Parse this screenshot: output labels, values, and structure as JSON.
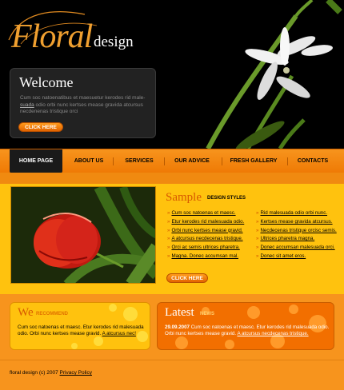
{
  "logo": {
    "floral": "Floral",
    "design": "design"
  },
  "welcome": {
    "title": "Welcome",
    "text_before_link": "Cum soc natoenatibus et maesuetur kerodes rid male-",
    "link": "suada",
    "text_after_link": " odio orbi nunc kertses mease gravida atcursus necdenenas tristique orci",
    "button": "CLICK HERE"
  },
  "nav": [
    "HOME PAGE",
    "ABOUT US",
    "SERVICES",
    "OUR ADVICE",
    "FRESH GALLERY",
    "CONTACTS"
  ],
  "sample": {
    "title": "Sample",
    "subtitle": "DESIGN STYLES",
    "left_items": [
      "Cum soc natoenas et maesc.",
      "Etur kerodes rid malesuada odio.",
      "Orbi nunc kertses mease gravid.",
      "A atcursus necdecenas tristique.",
      "Orci ac semis ultrices pharetra.",
      "Magna. Donec accumsan mal."
    ],
    "right_items": [
      "Rid malesuada odio orbi nunc.",
      "Kertses mease gravida atcursus.",
      "Necdecenas tristique orcisc semis.",
      "Ultrices pharetra magna.",
      "Donec accumsan malesuada orci.",
      "Donec sit amet eros."
    ],
    "button": "CLICK HERE"
  },
  "we": {
    "title": "We",
    "subtitle": "RECOMMEND",
    "text": "Cum soc natoenas et maesc. Etur kerodes rid malesuada odio. Orbi nunc kertses mease gravid.",
    "link": "A atcursus nec!"
  },
  "latest": {
    "title": "Latest",
    "subtitle": "NEWS",
    "date": "29.09.2007",
    "text": " Cum soc natoenas et maesc. Etur kerodes rid malesuada odio. Orbi nunc kertses mease gravid.",
    "link": "A atcursus necdecenas tristique."
  },
  "footer": {
    "text": "floral design (c) 2007 ",
    "link": "Privacy Policy"
  },
  "colors": {
    "accent": "#f7941d",
    "yellow": "#ffc20e",
    "dark": "#000000"
  }
}
